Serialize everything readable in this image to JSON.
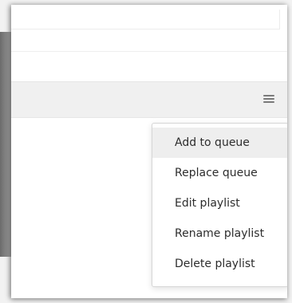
{
  "header": {
    "menu_icon": "hamburger-menu-icon"
  },
  "menu": {
    "items": [
      {
        "label": "Add to queue"
      },
      {
        "label": "Replace queue"
      },
      {
        "label": "Edit playlist"
      },
      {
        "label": "Rename playlist"
      },
      {
        "label": "Delete playlist"
      }
    ]
  }
}
